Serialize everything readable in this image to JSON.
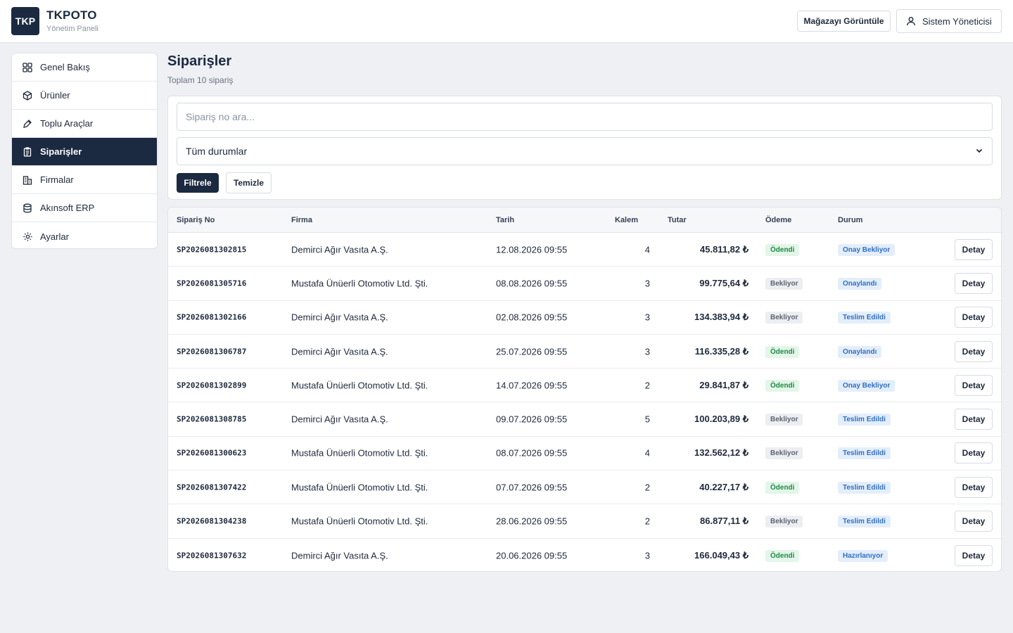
{
  "header": {
    "logo": "TKP",
    "brand": "TKPOTO",
    "subtitle": "Yönetim Paneli",
    "store_button": "Mağazayı Görüntüle",
    "user_button": "Sistem Yöneticisi"
  },
  "sidebar": {
    "items": [
      {
        "label": "Genel Bakış",
        "icon": "grid-icon",
        "active": false
      },
      {
        "label": "Ürünler",
        "icon": "box-icon",
        "active": false
      },
      {
        "label": "Toplu Araçlar",
        "icon": "tag-icon",
        "active": false
      },
      {
        "label": "Siparişler",
        "icon": "clipboard-icon",
        "active": true
      },
      {
        "label": "Firmalar",
        "icon": "building-icon",
        "active": false
      },
      {
        "label": "Akınsoft ERP",
        "icon": "database-icon",
        "active": false
      },
      {
        "label": "Ayarlar",
        "icon": "gear-icon",
        "active": false
      }
    ]
  },
  "page": {
    "title": "Siparişler",
    "subtitle": "Toplam 10 sipariş"
  },
  "filters": {
    "search_placeholder": "Sipariş no ara...",
    "search_value": "",
    "status_selected": "Tüm durumlar",
    "filter_button": "Filtrele",
    "clear_button": "Temizle"
  },
  "table": {
    "columns": [
      "Sipariş No",
      "Firma",
      "Tarih",
      "Kalem",
      "Tutar",
      "Ödeme",
      "Durum"
    ],
    "detail_label": "Detay",
    "rows": [
      {
        "no": "SP2026081302815",
        "firma": "Demirci Ağır Vasıta A.Ş.",
        "tarih": "12.08.2026 09:55",
        "kalem": "4",
        "tutar": "45.811,82 ₺",
        "odeme": "Ödendi",
        "durum": "Onay Bekliyor"
      },
      {
        "no": "SP2026081305716",
        "firma": "Mustafa Ünüerli Otomotiv Ltd. Şti.",
        "tarih": "08.08.2026 09:55",
        "kalem": "3",
        "tutar": "99.775,64 ₺",
        "odeme": "Bekliyor",
        "durum": "Onaylandı"
      },
      {
        "no": "SP2026081302166",
        "firma": "Demirci Ağır Vasıta A.Ş.",
        "tarih": "02.08.2026 09:55",
        "kalem": "3",
        "tutar": "134.383,94 ₺",
        "odeme": "Bekliyor",
        "durum": "Teslim Edildi"
      },
      {
        "no": "SP2026081306787",
        "firma": "Demirci Ağır Vasıta A.Ş.",
        "tarih": "25.07.2026 09:55",
        "kalem": "3",
        "tutar": "116.335,28 ₺",
        "odeme": "Ödendi",
        "durum": "Onaylandı"
      },
      {
        "no": "SP2026081302899",
        "firma": "Mustafa Ünüerli Otomotiv Ltd. Şti.",
        "tarih": "14.07.2026 09:55",
        "kalem": "2",
        "tutar": "29.841,87 ₺",
        "odeme": "Ödendi",
        "durum": "Onay Bekliyor"
      },
      {
        "no": "SP2026081308785",
        "firma": "Demirci Ağır Vasıta A.Ş.",
        "tarih": "09.07.2026 09:55",
        "kalem": "5",
        "tutar": "100.203,89 ₺",
        "odeme": "Bekliyor",
        "durum": "Teslim Edildi"
      },
      {
        "no": "SP2026081300623",
        "firma": "Mustafa Ünüerli Otomotiv Ltd. Şti.",
        "tarih": "08.07.2026 09:55",
        "kalem": "4",
        "tutar": "132.562,12 ₺",
        "odeme": "Bekliyor",
        "durum": "Teslim Edildi"
      },
      {
        "no": "SP2026081307422",
        "firma": "Mustafa Ünüerli Otomotiv Ltd. Şti.",
        "tarih": "07.07.2026 09:55",
        "kalem": "2",
        "tutar": "40.227,17 ₺",
        "odeme": "Ödendi",
        "durum": "Teslim Edildi"
      },
      {
        "no": "SP2026081304238",
        "firma": "Mustafa Ünüerli Otomotiv Ltd. Şti.",
        "tarih": "28.06.2026 09:55",
        "kalem": "2",
        "tutar": "86.877,11 ₺",
        "odeme": "Bekliyor",
        "durum": "Teslim Edildi"
      },
      {
        "no": "SP2026081307632",
        "firma": "Demirci Ağır Vasıta A.Ş.",
        "tarih": "20.06.2026 09:55",
        "kalem": "3",
        "tutar": "166.049,43 ₺",
        "odeme": "Ödendi",
        "durum": "Hazırlanıyor"
      }
    ]
  },
  "colors": {
    "primary": "#1b2a41",
    "background": "#eef0f3",
    "paid_bg": "#e3f6e9",
    "paid_text": "#1f8a43",
    "waiting_bg": "#eceef1",
    "status_bg": "#e4eefb",
    "status_text": "#2f6fc4"
  }
}
